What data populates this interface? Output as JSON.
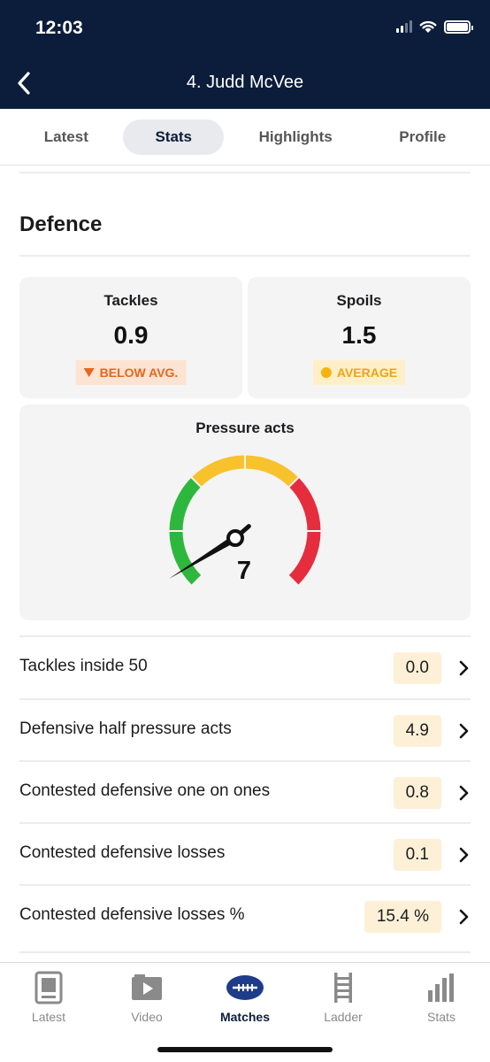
{
  "status_bar": {
    "time": "12:03"
  },
  "header": {
    "title": "4. Judd McVee"
  },
  "tabs": [
    {
      "label": "Latest",
      "active": false
    },
    {
      "label": "Stats",
      "active": true
    },
    {
      "label": "Highlights",
      "active": false
    },
    {
      "label": "Profile",
      "active": false
    }
  ],
  "section": {
    "title": "Defence"
  },
  "cards": [
    {
      "label": "Tackles",
      "value": "0.9",
      "badge": "BELOW AVG.",
      "badge_type": "below"
    },
    {
      "label": "Spoils",
      "value": "1.5",
      "badge": "AVERAGE",
      "badge_type": "average"
    }
  ],
  "gauge": {
    "label": "Pressure acts",
    "value": "7",
    "needle_level": 0.05,
    "colors": {
      "low": "#2db83d",
      "mid": "#f7c22c",
      "high": "#e52d3e"
    }
  },
  "rows": [
    {
      "label": "Tackles inside 50",
      "value": "0.0"
    },
    {
      "label": "Defensive half pressure acts",
      "value": "4.9"
    },
    {
      "label": "Contested defensive one on ones",
      "value": "0.8"
    },
    {
      "label": "Contested defensive losses",
      "value": "0.1"
    },
    {
      "label": "Contested defensive losses %",
      "value": "15.4 %"
    }
  ],
  "bottom_nav": [
    {
      "label": "Latest",
      "icon": "news-icon",
      "active": false
    },
    {
      "label": "Video",
      "icon": "video-icon",
      "active": false
    },
    {
      "label": "Matches",
      "icon": "football-icon",
      "active": true
    },
    {
      "label": "Ladder",
      "icon": "ladder-icon",
      "active": false
    },
    {
      "label": "Stats",
      "icon": "bar-chart-icon",
      "active": false
    }
  ],
  "theme": {
    "navy": "#0b1d3a",
    "value_bg": "#fdf0d7",
    "card_bg": "#f4f4f5"
  }
}
